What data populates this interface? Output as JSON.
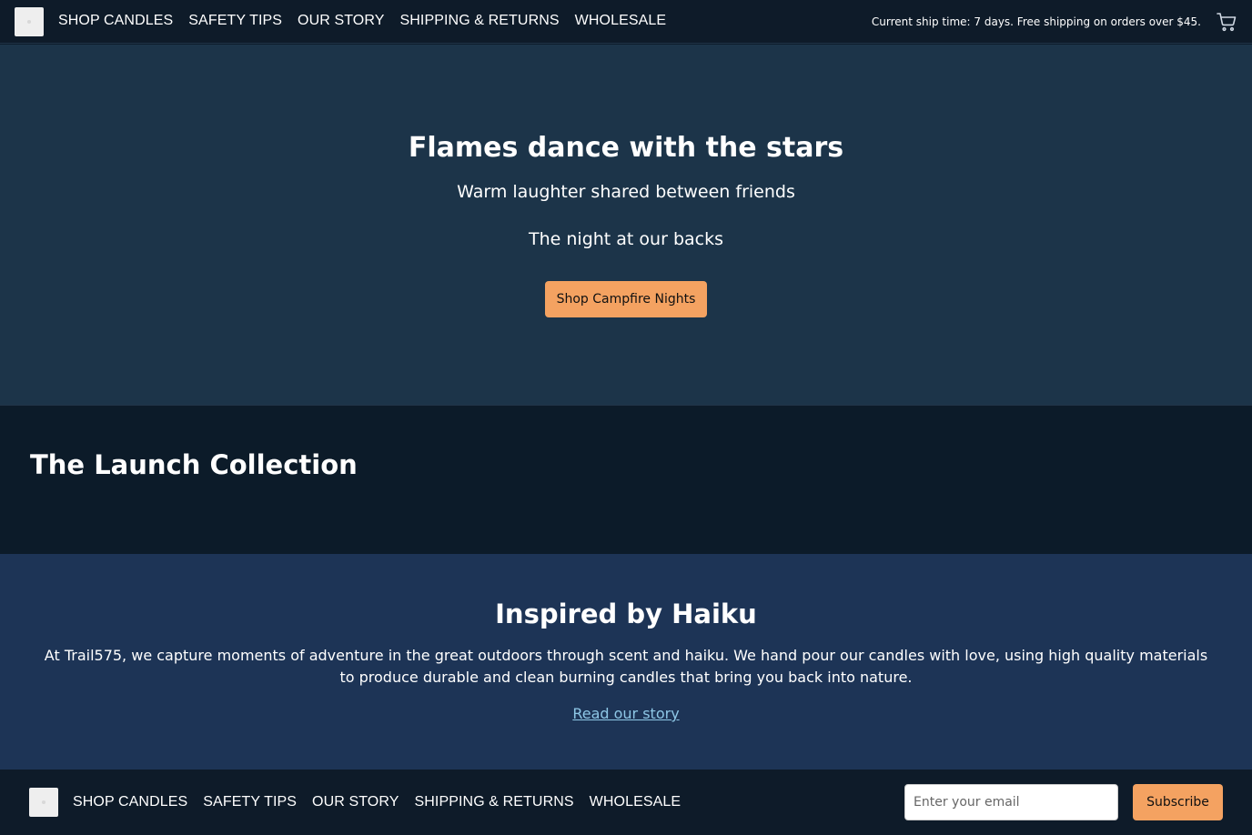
{
  "header": {
    "logo_icon": "logo-placeholder",
    "nav": [
      {
        "label": "SHOP CANDLES"
      },
      {
        "label": "SAFETY TIPS"
      },
      {
        "label": "OUR STORY"
      },
      {
        "label": "SHIPPING & RETURNS"
      },
      {
        "label": "WHOLESALE"
      }
    ],
    "ship_notice": "Current ship time: 7 days. Free shipping on orders over $45.",
    "cart_icon": "shopping-cart-icon"
  },
  "hero": {
    "title": "Flames dance with the stars",
    "line1": "Warm laughter shared between friends",
    "line2": "The night at our backs",
    "button_label": "Shop Campfire Nights"
  },
  "launch": {
    "title": "The Launch Collection"
  },
  "about": {
    "title": "Inspired by Haiku",
    "text": "At Trail575, we capture moments of adventure in the great outdoors through scent and haiku. We hand pour our candles with love, using high quality materials to produce durable and clean burning candles that bring you back into nature.",
    "link_label": "Read our story"
  },
  "footer": {
    "nav": [
      {
        "label": "SHOP CANDLES"
      },
      {
        "label": "SAFETY TIPS"
      },
      {
        "label": "OUR STORY"
      },
      {
        "label": "SHIPPING & RETURNS"
      },
      {
        "label": "WHOLESALE"
      }
    ],
    "email_placeholder": "Enter your email",
    "subscribe_label": "Subscribe"
  },
  "colors": {
    "nav_bg": "#0e1b29",
    "hero_bg": "#1c3449",
    "launch_bg": "#0c1b29",
    "about_bg": "#1d3456",
    "accent": "#f4a261",
    "link": "#8ec7e6"
  }
}
